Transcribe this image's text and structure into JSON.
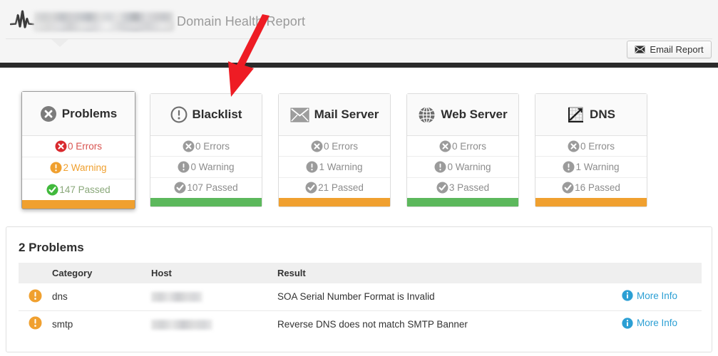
{
  "header": {
    "logo_icon": "pulse-logo-icon",
    "domain_redacted": "",
    "report_title": "Domain Health Report",
    "email_button": {
      "label": "Email Report",
      "icon": "envelope-icon"
    }
  },
  "cards": [
    {
      "id": "problems",
      "title": "Problems",
      "icon": "circle-x-icon",
      "selected": true,
      "status_color": "#f0a02f",
      "stats": [
        {
          "icon": "error-icon",
          "label": "0 Errors",
          "state": "error",
          "active": true
        },
        {
          "icon": "warning-icon",
          "label": "2 Warning",
          "state": "warn",
          "active": true
        },
        {
          "icon": "check-icon",
          "label": "147 Passed",
          "state": "passed",
          "active": true
        }
      ]
    },
    {
      "id": "blacklist",
      "title": "Blacklist",
      "icon": "circle-exclamation-icon",
      "selected": false,
      "status_color": "#5cb85c",
      "stats": [
        {
          "icon": "error-icon",
          "label": "0 Errors",
          "state": "error",
          "active": false
        },
        {
          "icon": "warning-icon",
          "label": "0 Warning",
          "state": "warn",
          "active": false
        },
        {
          "icon": "check-icon",
          "label": "107 Passed",
          "state": "passed",
          "active": false
        }
      ]
    },
    {
      "id": "mail-server",
      "title": "Mail Server",
      "icon": "envelope-icon",
      "selected": false,
      "status_color": "#f0a02f",
      "stats": [
        {
          "icon": "error-icon",
          "label": "0 Errors",
          "state": "error",
          "active": false
        },
        {
          "icon": "warning-icon",
          "label": "1 Warning",
          "state": "warn",
          "active": false
        },
        {
          "icon": "check-icon",
          "label": "21 Passed",
          "state": "passed",
          "active": false
        }
      ]
    },
    {
      "id": "web-server",
      "title": "Web Server",
      "icon": "globe-icon",
      "selected": false,
      "status_color": "#5cb85c",
      "stats": [
        {
          "icon": "error-icon",
          "label": "0 Errors",
          "state": "error",
          "active": false
        },
        {
          "icon": "warning-icon",
          "label": "0 Warning",
          "state": "warn",
          "active": false
        },
        {
          "icon": "check-icon",
          "label": "3 Passed",
          "state": "passed",
          "active": false
        }
      ]
    },
    {
      "id": "dns",
      "title": "DNS",
      "icon": "chart-graph-icon",
      "selected": false,
      "status_color": "#f0a02f",
      "stats": [
        {
          "icon": "error-icon",
          "label": "0 Errors",
          "state": "error",
          "active": false
        },
        {
          "icon": "warning-icon",
          "label": "1 Warning",
          "state": "warn",
          "active": false
        },
        {
          "icon": "check-icon",
          "label": "16 Passed",
          "state": "passed",
          "active": false
        }
      ]
    }
  ],
  "problems_panel": {
    "title": "2 Problems",
    "columns": [
      "",
      "Category",
      "Host",
      "Result",
      ""
    ],
    "rows": [
      {
        "severity_icon": "warning-icon",
        "category": "dns",
        "host_redacted": "",
        "result": "SOA Serial Number Format is Invalid",
        "more_info": {
          "label": "More Info",
          "icon": "info-icon"
        }
      },
      {
        "severity_icon": "warning-icon",
        "category": "smtp",
        "host_redacted": "",
        "result": "Reverse DNS does not match SMTP Banner",
        "more_info": {
          "label": "More Info",
          "icon": "info-icon"
        }
      }
    ]
  },
  "annotation": {
    "arrow_icon": "red-arrow-icon",
    "arrow_color": "#ee1c24",
    "points_at": "blacklist"
  },
  "colors": {
    "orange": "#f0a02f",
    "green": "#5cb85c",
    "red": "#d9534f",
    "link_blue": "#2b9fd4",
    "dark_bar": "#2b2b2b",
    "header_bg": "#f5f5f5"
  }
}
